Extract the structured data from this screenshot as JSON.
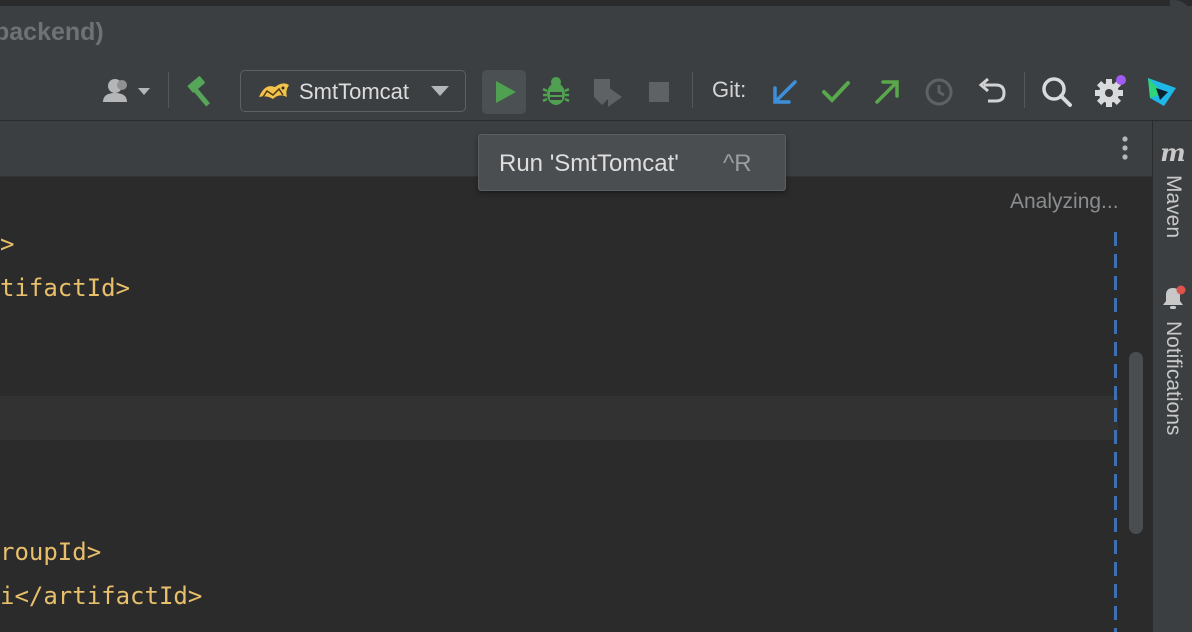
{
  "window": {
    "title_fragment": "backend)"
  },
  "toolbar": {
    "user_menu_icon": "user-dropdown-icon",
    "build_icon": "hammer-icon",
    "run_config": {
      "label": "SmtTomcat",
      "icon": "tomcat-icon"
    },
    "run_icon": "play-icon",
    "debug_icon": "bug-icon",
    "coverage_icon": "run-with-coverage-icon",
    "stop_icon": "stop-icon",
    "git_label": "Git:",
    "git_update_icon": "arrow-down-left-icon",
    "git_commit_icon": "checkmark-icon",
    "git_push_icon": "arrow-up-right-icon",
    "git_history_icon": "clock-icon",
    "git_rollback_icon": "undo-icon",
    "search_icon": "search-icon",
    "settings_icon": "gear-icon",
    "product_icon": "toolbox-logo-icon",
    "colors": {
      "run_green": "#4fa050",
      "git_blue": "#3d8fd9",
      "git_green": "#59a84b",
      "badge": "#a05cf0"
    }
  },
  "tooltip": {
    "text": "Run 'SmtTomcat'",
    "shortcut": "^R"
  },
  "editor": {
    "status": "Analyzing...",
    "lines": [
      {
        "text": ">"
      },
      {
        "text": "tifactId>"
      },
      {
        "text": "roupId>"
      },
      {
        "text": "i</artifactId>"
      }
    ]
  },
  "tool_window_strip": {
    "maven_label": "Maven",
    "notifications_label": "Notifications",
    "notification_badge_color": "#e0524c"
  }
}
